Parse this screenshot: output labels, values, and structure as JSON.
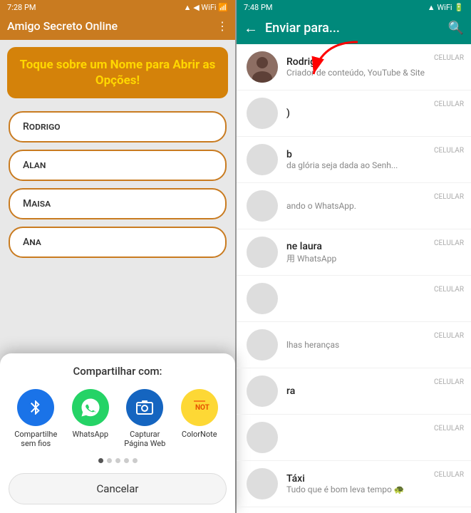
{
  "left": {
    "status_bar": {
      "time": "7:28 PM",
      "icons": "signal wifi battery"
    },
    "top_bar": {
      "title": "Amigo Secreto Online",
      "menu_icon": "⋮"
    },
    "banner": {
      "text": "Toque sobre um Nome para Abrir as Opções!"
    },
    "names": [
      {
        "label": "Rodrigo"
      },
      {
        "label": "Alan"
      },
      {
        "label": "Maisa"
      },
      {
        "label": "Ana"
      }
    ],
    "share_dialog": {
      "title": "Compartilhar com:",
      "apps": [
        {
          "name": "compartilhe-sem-fios",
          "label": "Compartilhe sem fios",
          "icon": "🔗",
          "bg": "#1a73e8"
        },
        {
          "name": "whatsapp",
          "label": "WhatsApp",
          "icon": "W",
          "bg": "#25d366"
        },
        {
          "name": "capturar-pagina-web",
          "label": "Capturar Página Web",
          "icon": "📷",
          "bg": "#1565c0"
        },
        {
          "name": "colornote",
          "label": "ColorNote",
          "icon": "📝",
          "bg": "#fdd835"
        }
      ],
      "cancel_label": "Cancelar"
    }
  },
  "right": {
    "status_bar": {
      "time": "7:48 PM",
      "icons": "signal wifi battery"
    },
    "top_bar": {
      "title": "Enviar para...",
      "back_icon": "←",
      "search_icon": "🔍"
    },
    "contacts": [
      {
        "name": "Rodrigo",
        "sub": "Criador de conteúdo, YouTube & Site",
        "type": "CELULAR",
        "has_avatar": true
      },
      {
        "name": ")",
        "sub": "",
        "type": "CELULAR",
        "has_avatar": false
      },
      {
        "name": "b",
        "sub": "da glória seja dada ao Senh...",
        "type": "CELULAR",
        "has_avatar": false
      },
      {
        "name": "",
        "sub": "ando o WhatsApp.",
        "type": "CELULAR",
        "has_avatar": false
      },
      {
        "name": "ne laura",
        "sub": "用 WhatsApp",
        "type": "CELULAR",
        "has_avatar": false
      },
      {
        "name": "",
        "sub": "",
        "type": "CELULAR",
        "has_avatar": false
      },
      {
        "name": "",
        "sub": "lhas heranças",
        "type": "CELULAR",
        "has_avatar": false
      },
      {
        "name": "ra",
        "sub": "",
        "type": "CELULAR",
        "has_avatar": false
      },
      {
        "name": "",
        "sub": "",
        "type": "CELULAR",
        "has_avatar": false
      },
      {
        "name": "Táxi",
        "sub": "Tudo que é bom leva tempo 🐢",
        "type": "CELULAR",
        "has_avatar": false
      }
    ]
  }
}
